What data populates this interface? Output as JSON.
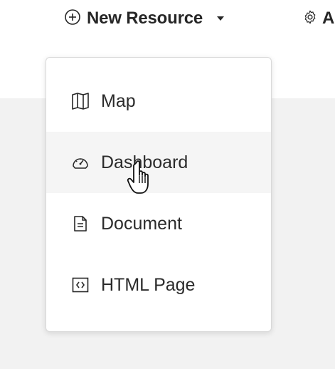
{
  "toolbar": {
    "new_resource_label": "New Resource",
    "new_resource_icon": "plus-circle-icon",
    "next_item_icon": "gear-icon",
    "next_item_partial": "A"
  },
  "menu": {
    "items": [
      {
        "label": "Map",
        "icon": "map-icon",
        "hovered": false
      },
      {
        "label": "Dashboard",
        "icon": "dashboard-gauge-icon",
        "hovered": true
      },
      {
        "label": "Document",
        "icon": "document-icon",
        "hovered": false
      },
      {
        "label": "HTML Page",
        "icon": "html-code-icon",
        "hovered": false
      }
    ]
  },
  "colors": {
    "text": "#262626",
    "canvas": "#f2f2f2",
    "hover": "#f5f5f5",
    "menu_border": "#d9d9d9"
  }
}
